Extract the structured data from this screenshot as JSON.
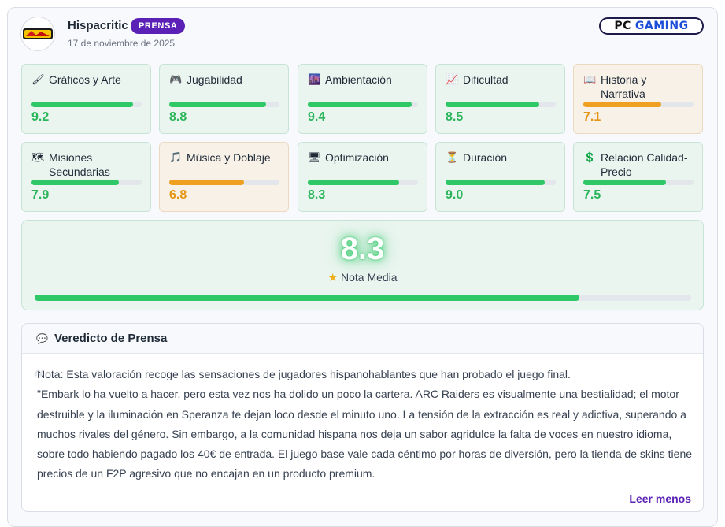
{
  "review": {
    "author": "Hispacritic",
    "badge": "PRENSA",
    "date": "17 de noviembre de 2025",
    "avatar_logo_text": "Hispacritic",
    "source_logo": {
      "part1": "PC",
      "part2": "GAMING"
    }
  },
  "scores": [
    {
      "icon": "🖌",
      "icon_name": "brush-icon",
      "label": "Gráficos y Arte",
      "value": "9.2",
      "fraction": 0.92,
      "status": "good"
    },
    {
      "icon": "🎮",
      "icon_name": "gamepad-icon",
      "label": "Jugabilidad",
      "value": "8.8",
      "fraction": 0.88,
      "status": "good"
    },
    {
      "icon": "🌆",
      "icon_name": "cityscape-icon",
      "label": "Ambientación",
      "value": "9.4",
      "fraction": 0.94,
      "status": "good"
    },
    {
      "icon": "📈",
      "icon_name": "chart-icon",
      "label": "Dificultad",
      "value": "8.5",
      "fraction": 0.85,
      "status": "good"
    },
    {
      "icon": "📖",
      "icon_name": "book-icon",
      "label": "Historia y Narrativa",
      "value": "7.1",
      "fraction": 0.71,
      "status": "warn"
    },
    {
      "icon": "🗺",
      "icon_name": "map-icon",
      "label": "Misiones Secundarias",
      "value": "7.9",
      "fraction": 0.79,
      "status": "good"
    },
    {
      "icon": "🎵",
      "icon_name": "music-icon",
      "label": "Música y Doblaje",
      "value": "6.8",
      "fraction": 0.68,
      "status": "warn"
    },
    {
      "icon": "🖥",
      "icon_name": "monitor-icon",
      "label": "Optimización",
      "value": "8.3",
      "fraction": 0.83,
      "status": "good"
    },
    {
      "icon": "⏳",
      "icon_name": "hourglass-icon",
      "label": "Duración",
      "value": "9.0",
      "fraction": 0.9,
      "status": "good"
    },
    {
      "icon": "💲",
      "icon_name": "dollar-icon",
      "label": "Relación Calidad-Precio",
      "value": "7.5",
      "fraction": 0.75,
      "status": "good"
    }
  ],
  "average": {
    "value": "8.3",
    "label": "Nota Media",
    "fraction": 0.83
  },
  "verdict": {
    "title": "Veredicto de Prensa",
    "note": "Nota: Esta valoración recoge las sensaciones de jugadores hispanohablantes que han probado el juego final.",
    "quote": "\"Embark lo ha vuelto a hacer, pero esta vez nos ha dolido un poco la cartera. ARC Raiders es visualmente una bestialidad; el motor destruible y la iluminación en Speranza te dejan loco desde el minuto uno. La tensión de la extracción es real y adictiva, superando a muchos rivales del género. Sin embargo, a la comunidad hispana nos deja un sabor agridulce la falta de voces en nuestro idioma, sobre todo habiendo pagado los 40€ de entrada. El juego base vale cada céntimo por horas de diversión, pero la tienda de skins tiene precios de un F2P agresivo que no encajan en un producto premium.",
    "read_less": "Leer menos"
  },
  "colors": {
    "good": "#2ec866",
    "warn": "#f0a020",
    "badge": "#5b21b6",
    "link": "#5b21b6"
  }
}
